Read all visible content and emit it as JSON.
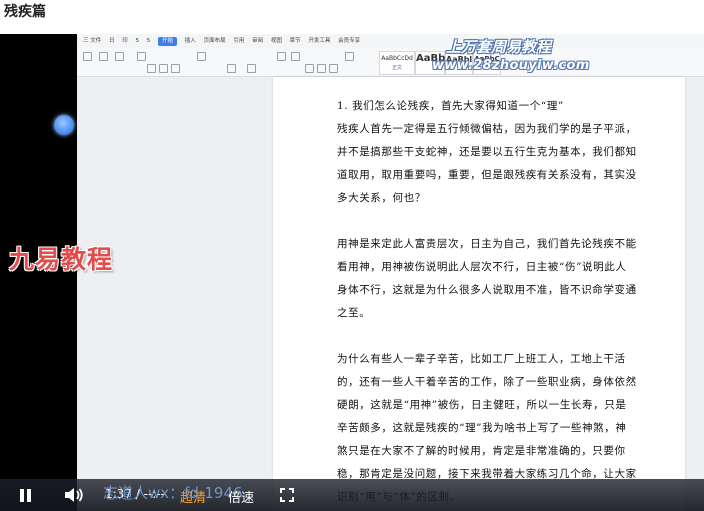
{
  "page": {
    "title": "残疾篇"
  },
  "wps": {
    "menu": [
      "三 文件",
      "日",
      "印",
      "5",
      "5",
      "开始",
      "插入",
      "页面布局",
      "引用",
      "审阅",
      "视图",
      "章节",
      "开发工具",
      "会员专享"
    ],
    "active_menu": "开始",
    "styles": [
      {
        "preview": "AaBbCcDd",
        "name": "正文"
      },
      {
        "preview": "AaBb",
        "name": ""
      },
      {
        "preview": "AaBbl",
        "name": ""
      },
      {
        "preview": "AaBbC",
        "name": ""
      }
    ]
  },
  "watermarks": {
    "brand": "九易教程",
    "top": "上万套周易教程",
    "url": "www.28zhouyiw.com"
  },
  "document": {
    "paragraphs": [
      "1. 我们怎么论残疾，首先大家得知道一个“理”\n残疾人首先一定得是五行倾微偏枯，因为我们学的是子平派，并不是搞那些干支蛇神，还是要以五行生克为基本，我们都知道取用，取用重要吗，重要，但是跟残疾有关系没有，其实没多大关系，何也？",
      "用神是来定此人富贵层次，日主为自己，我们首先论残疾不能看用神，用神被伤说明此人层次不行，日主被“伤”说明此人身体不行，这就是为什么很多人说取用不准，皆不识命学变通之至。",
      "为什么有些人一辈子辛苦，比如工厂上班工人，工地上干活的，还有一些人干着辛苦的工作，除了一些职业病，身体依然硬朗，这就是“用神”被伤，日主健旺，所以一生长寿，只是辛苦颇多，这就是残疾的“理”我为啥书上写了一些神煞，神煞只是在大家不了解的时候用，肯定是非常准确的，只要你稳，那肯定是没问题，接下来我带着大家练习几个命，让大家识别“用”与“体”的区别。"
    ]
  },
  "player": {
    "time": "1:37 / --:--",
    "contact": "志道人wx：fd-1946",
    "quality": "超清",
    "speed": "倍速"
  },
  "colors": {
    "active_tab": "#3d7eea",
    "quality_label": "#f0a030",
    "brand_watermark": "#e44c4c"
  }
}
